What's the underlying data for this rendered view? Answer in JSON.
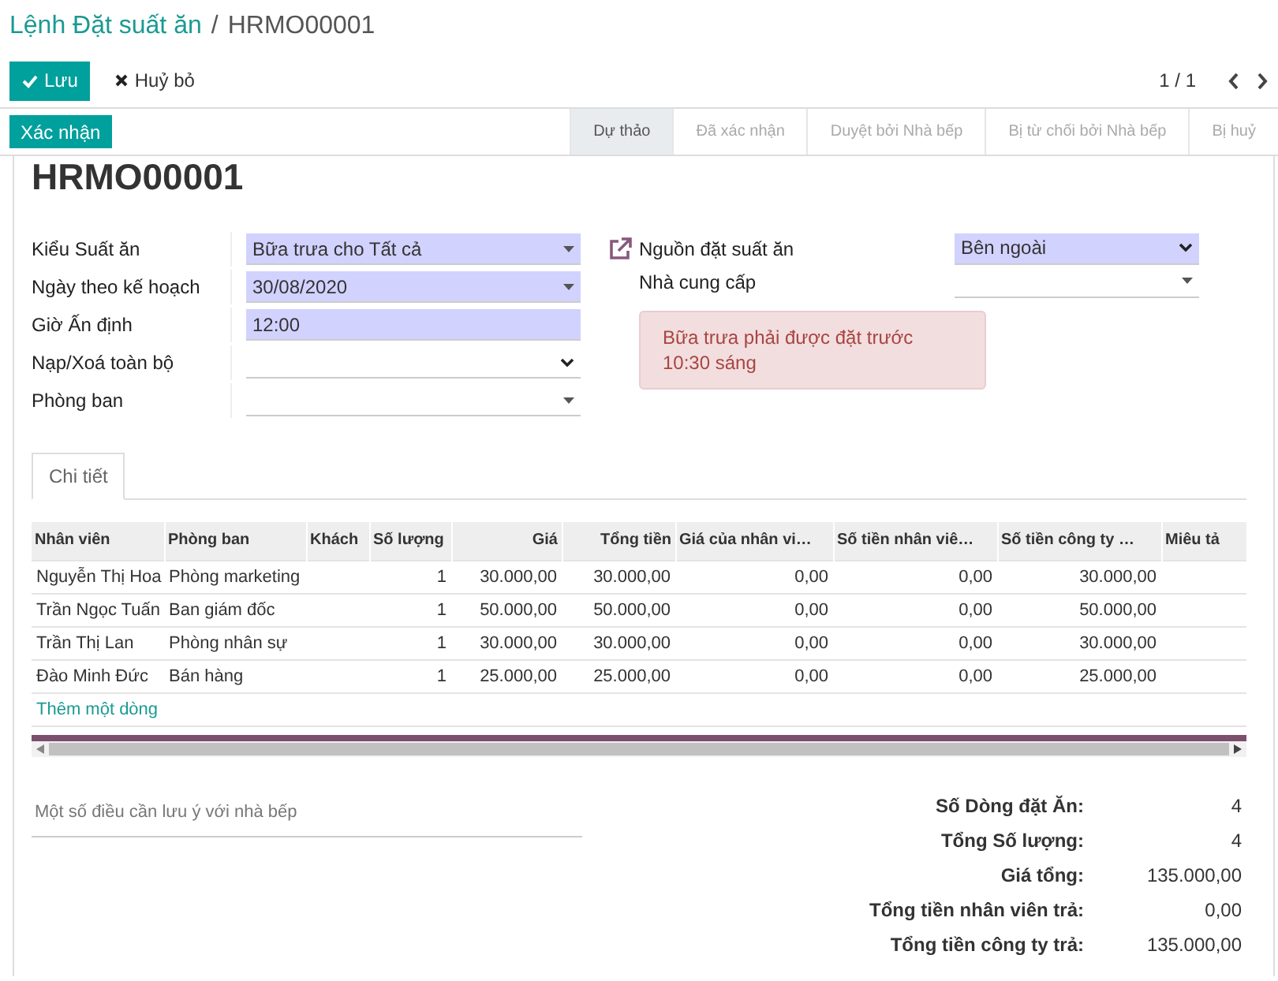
{
  "breadcrumb": {
    "parent": "Lệnh Đặt suất ăn",
    "separator": "/",
    "current": "HRMO00001"
  },
  "buttons": {
    "save": "Lưu",
    "discard": "Huỷ bỏ"
  },
  "pager": {
    "value": "1 / 1"
  },
  "confirm_button": "Xác nhận",
  "stages": [
    {
      "label": "Dự thảo",
      "selected": true
    },
    {
      "label": "Đã xác nhận",
      "selected": false
    },
    {
      "label": "Duyệt bởi Nhà bếp",
      "selected": false
    },
    {
      "label": "Bị từ chối bởi Nhà bếp",
      "selected": false
    },
    {
      "label": "Bị huỷ",
      "selected": false
    }
  ],
  "title": "HRMO00001",
  "left_fields": [
    {
      "label": "Kiểu Suất ăn",
      "value": "Bữa trưa cho Tất cả",
      "kind": "many2one",
      "required": true
    },
    {
      "label": "Ngày theo kế hoạch",
      "value": "30/08/2020",
      "kind": "many2one",
      "required": true
    },
    {
      "label": "Giờ Ấn định",
      "value": "12:00",
      "kind": "text",
      "required": true
    },
    {
      "label": "Nạp/Xoá toàn bộ",
      "kind": "select",
      "required": false
    },
    {
      "label": "Phòng ban",
      "kind": "many2one",
      "required": false
    }
  ],
  "right_fields": [
    {
      "label": "Nguồn đặt suất ăn",
      "value": "Bên ngoài",
      "kind": "select",
      "required": true,
      "link": true
    },
    {
      "label": "Nhà cung cấp",
      "kind": "many2one",
      "required": false,
      "link": false
    }
  ],
  "alert": "Bữa trưa phải được đặt trước 10:30 sáng",
  "tabs": [
    {
      "label": "Chi tiết",
      "selected": true
    }
  ],
  "table": {
    "columns": [
      {
        "label": "Nhân viên",
        "kind": "text"
      },
      {
        "label": "Phòng ban",
        "kind": "text"
      },
      {
        "label": "Khách",
        "kind": "text"
      },
      {
        "label": "Số lượng",
        "kind": "number"
      },
      {
        "label": "Giá",
        "kind": "number"
      },
      {
        "label": "Tổng tiền",
        "kind": "number"
      },
      {
        "label": "Giá của nhân vi…",
        "kind": "number"
      },
      {
        "label": "Số tiền nhân viê…",
        "kind": "number"
      },
      {
        "label": "Số tiền công ty …",
        "kind": "number"
      },
      {
        "label": "Miêu tả",
        "kind": "text"
      }
    ],
    "rows": [
      [
        "Nguyễn Thị Hoa",
        "Phòng marketing",
        "",
        "1",
        "30.000,00",
        "30.000,00",
        "0,00",
        "0,00",
        "30.000,00",
        ""
      ],
      [
        "Trần Ngọc Tuấn",
        "Ban giám đốc",
        "",
        "1",
        "50.000,00",
        "50.000,00",
        "0,00",
        "0,00",
        "50.000,00",
        ""
      ],
      [
        "Trần Thị Lan",
        "Phòng nhân sự",
        "",
        "1",
        "30.000,00",
        "30.000,00",
        "0,00",
        "0,00",
        "30.000,00",
        ""
      ],
      [
        "Đào Minh Đức",
        "Bán hàng",
        "",
        "1",
        "25.000,00",
        "25.000,00",
        "0,00",
        "0,00",
        "25.000,00",
        ""
      ]
    ],
    "add_line": "Thêm một dòng"
  },
  "note": {
    "placeholder": "Một số điều cần lưu ý với nhà bếp"
  },
  "totals": [
    {
      "label": "Số Dòng đặt Ăn:",
      "value": "4"
    },
    {
      "label": "Tổng Số lượng:",
      "value": "4"
    },
    {
      "label": "Giá tổng:",
      "value": "135.000,00"
    },
    {
      "label": "Tổng tiền nhân viên trả:",
      "value": "0,00"
    },
    {
      "label": "Tổng tiền công ty trả:",
      "value": "135.000,00"
    }
  ]
}
